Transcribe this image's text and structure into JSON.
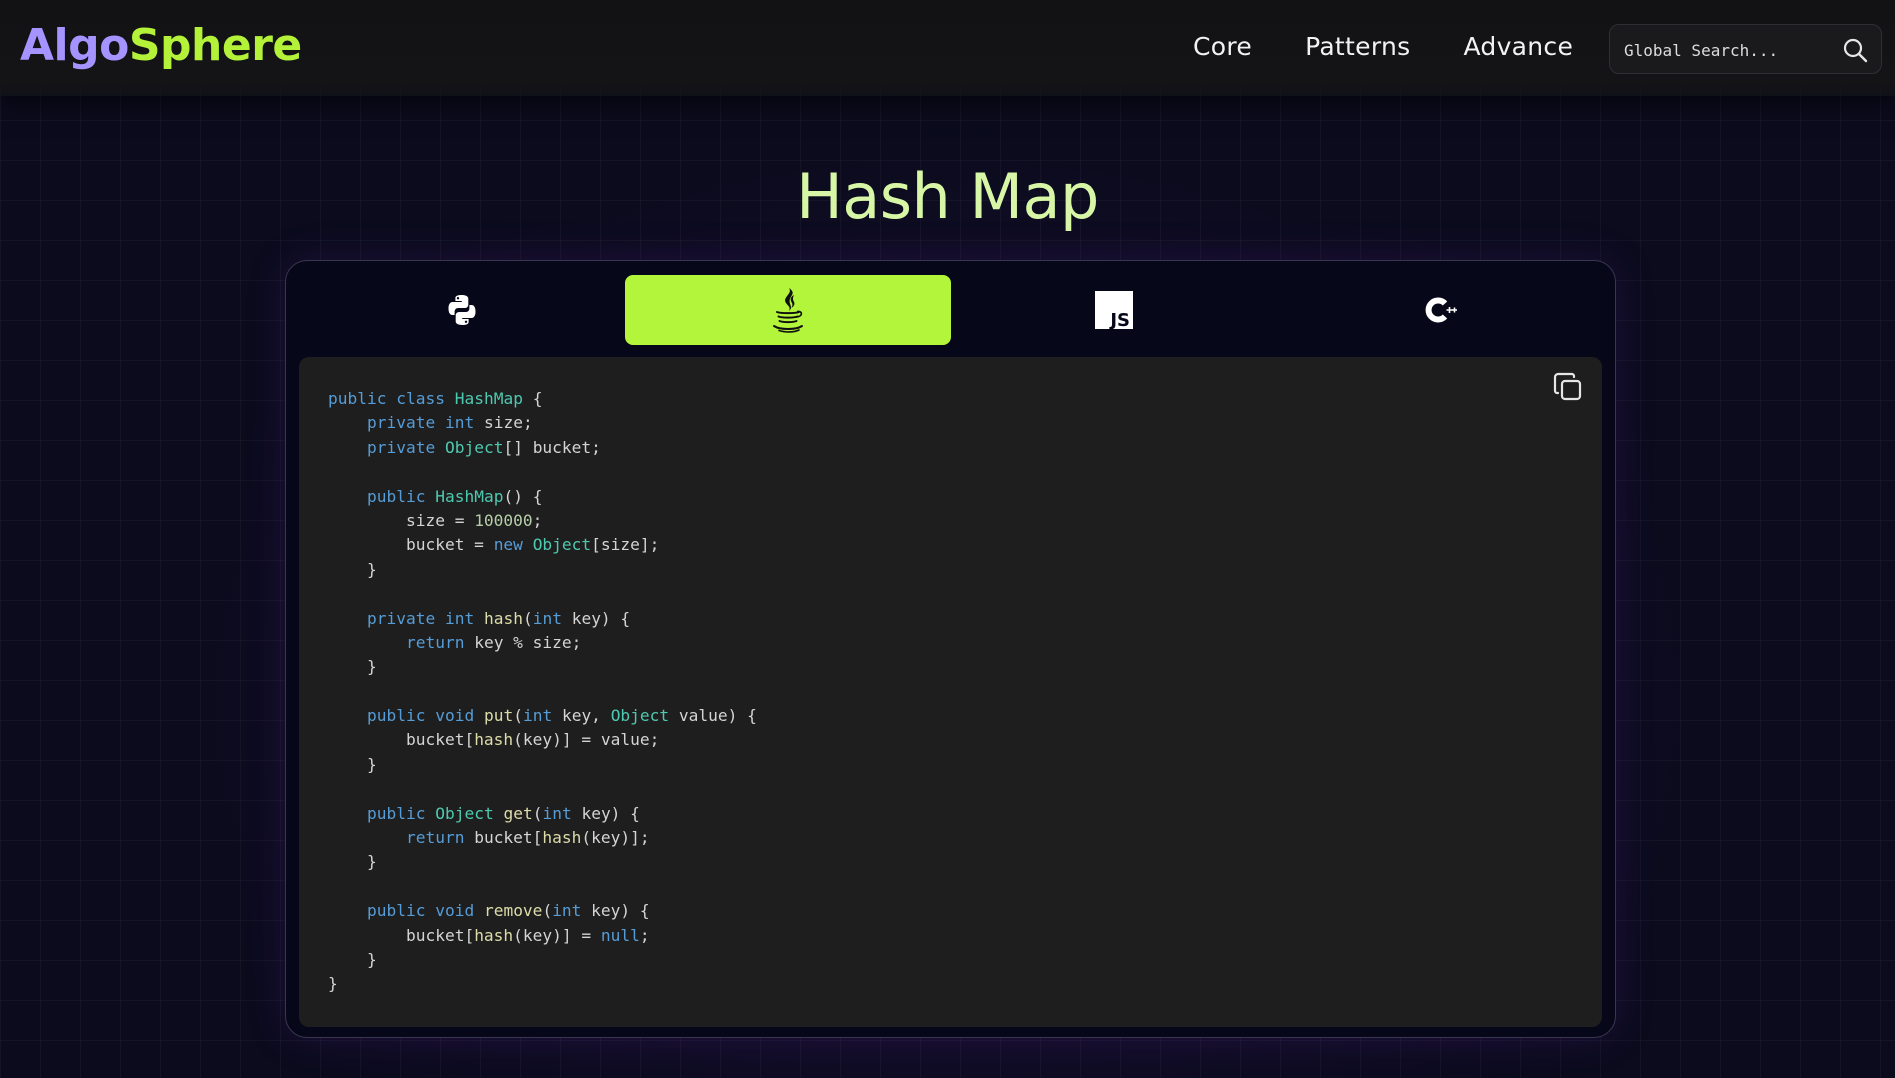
{
  "brand": {
    "part1": "Algo",
    "part2": "Sphere"
  },
  "nav": {
    "items": [
      "Core",
      "Patterns",
      "Advance"
    ]
  },
  "search": {
    "placeholder": "Global Search..."
  },
  "page": {
    "title": "Hash Map"
  },
  "languages": {
    "tabs": [
      {
        "icon": "python-icon",
        "active": false
      },
      {
        "icon": "java-icon",
        "active": true
      },
      {
        "icon": "javascript-icon",
        "label": "JS",
        "active": false
      },
      {
        "icon": "cpp-icon",
        "active": false
      }
    ]
  },
  "colors": {
    "accent": "#b2f53a",
    "logo_primary": "#a594ff",
    "title": "#d8f7a6",
    "code_bg": "#1e1e1e"
  },
  "code": {
    "language": "java",
    "lines": [
      [
        [
          "kw",
          "public"
        ],
        [
          "pl",
          " "
        ],
        [
          "kw",
          "class"
        ],
        [
          "pl",
          " "
        ],
        [
          "ty",
          "HashMap"
        ],
        [
          "pl",
          " {"
        ]
      ],
      [
        [
          "pl",
          "    "
        ],
        [
          "kw",
          "private"
        ],
        [
          "pl",
          " "
        ],
        [
          "kw",
          "int"
        ],
        [
          "pl",
          " size;"
        ]
      ],
      [
        [
          "pl",
          "    "
        ],
        [
          "kw",
          "private"
        ],
        [
          "pl",
          " "
        ],
        [
          "ty",
          "Object"
        ],
        [
          "pl",
          "[] bucket;"
        ]
      ],
      [
        [
          "pl",
          ""
        ]
      ],
      [
        [
          "pl",
          "    "
        ],
        [
          "kw",
          "public"
        ],
        [
          "pl",
          " "
        ],
        [
          "ty",
          "HashMap"
        ],
        [
          "pl",
          "() {"
        ]
      ],
      [
        [
          "pl",
          "        size = "
        ],
        [
          "num",
          "100000"
        ],
        [
          "pl",
          ";"
        ]
      ],
      [
        [
          "pl",
          "        bucket = "
        ],
        [
          "kw",
          "new"
        ],
        [
          "pl",
          " "
        ],
        [
          "ty",
          "Object"
        ],
        [
          "pl",
          "[size];"
        ]
      ],
      [
        [
          "pl",
          "    }"
        ]
      ],
      [
        [
          "pl",
          ""
        ]
      ],
      [
        [
          "pl",
          "    "
        ],
        [
          "kw",
          "private"
        ],
        [
          "pl",
          " "
        ],
        [
          "kw",
          "int"
        ],
        [
          "pl",
          " "
        ],
        [
          "fn",
          "hash"
        ],
        [
          "pl",
          "("
        ],
        [
          "kw",
          "int"
        ],
        [
          "pl",
          " key) {"
        ]
      ],
      [
        [
          "pl",
          "        "
        ],
        [
          "kw",
          "return"
        ],
        [
          "pl",
          " key % size;"
        ]
      ],
      [
        [
          "pl",
          "    }"
        ]
      ],
      [
        [
          "pl",
          ""
        ]
      ],
      [
        [
          "pl",
          "    "
        ],
        [
          "kw",
          "public"
        ],
        [
          "pl",
          " "
        ],
        [
          "kw",
          "void"
        ],
        [
          "pl",
          " "
        ],
        [
          "fn",
          "put"
        ],
        [
          "pl",
          "("
        ],
        [
          "kw",
          "int"
        ],
        [
          "pl",
          " key, "
        ],
        [
          "ty",
          "Object"
        ],
        [
          "pl",
          " value) {"
        ]
      ],
      [
        [
          "pl",
          "        bucket["
        ],
        [
          "fn",
          "hash"
        ],
        [
          "pl",
          "(key)] = value;"
        ]
      ],
      [
        [
          "pl",
          "    }"
        ]
      ],
      [
        [
          "pl",
          ""
        ]
      ],
      [
        [
          "pl",
          "    "
        ],
        [
          "kw",
          "public"
        ],
        [
          "pl",
          " "
        ],
        [
          "ty",
          "Object"
        ],
        [
          "pl",
          " "
        ],
        [
          "fn",
          "get"
        ],
        [
          "pl",
          "("
        ],
        [
          "kw",
          "int"
        ],
        [
          "pl",
          " key) {"
        ]
      ],
      [
        [
          "pl",
          "        "
        ],
        [
          "kw",
          "return"
        ],
        [
          "pl",
          " bucket["
        ],
        [
          "fn",
          "hash"
        ],
        [
          "pl",
          "(key)];"
        ]
      ],
      [
        [
          "pl",
          "    }"
        ]
      ],
      [
        [
          "pl",
          ""
        ]
      ],
      [
        [
          "pl",
          "    "
        ],
        [
          "kw",
          "public"
        ],
        [
          "pl",
          " "
        ],
        [
          "kw",
          "void"
        ],
        [
          "pl",
          " "
        ],
        [
          "fn",
          "remove"
        ],
        [
          "pl",
          "("
        ],
        [
          "kw",
          "int"
        ],
        [
          "pl",
          " key) {"
        ]
      ],
      [
        [
          "pl",
          "        bucket["
        ],
        [
          "fn",
          "hash"
        ],
        [
          "pl",
          "(key)] = "
        ],
        [
          "kw",
          "null"
        ],
        [
          "pl",
          ";"
        ]
      ],
      [
        [
          "pl",
          "    }"
        ]
      ],
      [
        [
          "pl",
          "}"
        ]
      ]
    ]
  }
}
